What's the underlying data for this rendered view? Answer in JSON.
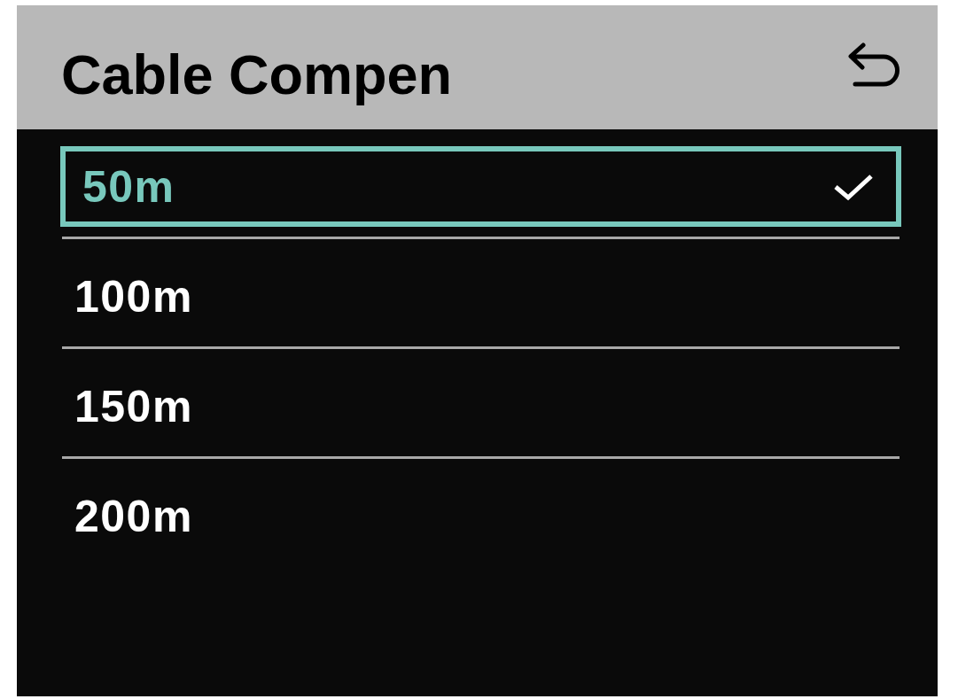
{
  "header": {
    "title": "Cable Compen"
  },
  "options": [
    {
      "label": "50m",
      "selected": true
    },
    {
      "label": "100m",
      "selected": false
    },
    {
      "label": "150m",
      "selected": false
    },
    {
      "label": "200m",
      "selected": false
    }
  ]
}
